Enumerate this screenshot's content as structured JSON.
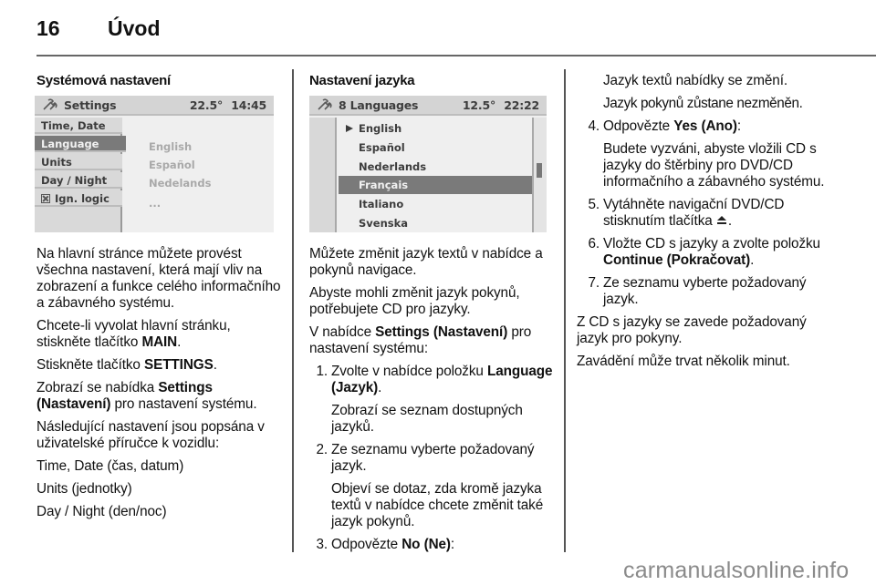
{
  "header": {
    "page_number": "16",
    "chapter_title": "Úvod"
  },
  "left_column": {
    "heading": "Systémová nastavení",
    "screen": {
      "title": "Settings",
      "icon": "wrench-icon",
      "temperature": "22.5°",
      "time": "14:45",
      "menu_items": [
        {
          "label": "Time, Date",
          "selected": false
        },
        {
          "label": "Language",
          "selected": true
        },
        {
          "label": "Units",
          "selected": false
        },
        {
          "label": "Day / Night",
          "selected": false
        },
        {
          "label": "Ign. logic",
          "selected": false,
          "checkbox": "checked-x"
        }
      ],
      "options": [
        "English",
        "Español",
        "Nedelands",
        "..."
      ]
    },
    "paragraphs": {
      "p1": "Na hlavní stránce můžete provést všechna nastavení, která mají vliv na zobrazení a funkce celého informačního a zábavného systému.",
      "p2_a": "Chcete-li vyvolat hlavní stránku, stiskněte tlačítko ",
      "p2_b": "MAIN",
      "p2_c": ".",
      "p3_a": "Stiskněte tlačítko ",
      "p3_b": "SETTINGS",
      "p3_c": ".",
      "p4_a": "Zobrazí se nabídka ",
      "p4_b": "Settings (Nastavení)",
      "p4_c": " pro nastavení systému.",
      "p5": "Následující nastavení jsou popsána v uživatelské příručce k vozidlu:",
      "p6": "Time, Date (čas, datum)",
      "p7": "Units (jednotky)",
      "p8": "Day / Night (den/noc)"
    }
  },
  "middle_column": {
    "heading": "Nastavení jazyka",
    "screen": {
      "title": "8 Languages",
      "icon": "wrench-icon",
      "temperature": "12.5°",
      "time": "22:22",
      "languages": [
        {
          "label": "English",
          "current": true,
          "selected": false
        },
        {
          "label": "Español",
          "current": false,
          "selected": false
        },
        {
          "label": "Nederlands",
          "current": false,
          "selected": false
        },
        {
          "label": "Français",
          "current": false,
          "selected": true
        },
        {
          "label": "Italiano",
          "current": false,
          "selected": false
        },
        {
          "label": "Svenska",
          "current": false,
          "selected": false
        }
      ],
      "scroll_position": 0.45
    },
    "paragraphs": {
      "p1": "Můžete změnit jazyk textů v nabídce a pokynů navigace.",
      "p2": "Abyste mohli změnit jazyk pokynů, potřebujete CD pro jazyky.",
      "p3_a": "V nabídce ",
      "p3_b": "Settings (Nastavení)",
      "p3_c": " pro nastavení systému:",
      "step1_num": "1.",
      "step1_a": "Zvolte v nabídce položku ",
      "step1_b": "Language (Jazyk)",
      "step1_c": ".",
      "step1_note": "Zobrazí se seznam dostupných jazyků.",
      "step2_num": "2.",
      "step2": "Ze seznamu vyberte požadovaný jazyk.",
      "step2_note": "Objeví se dotaz, zda kromě jazyka textů v nabídce chcete změnit také jazyk pokynů.",
      "step3_num": "3.",
      "step3_a": "Odpovězte ",
      "step3_b": "No (Ne)",
      "step3_c": ":"
    }
  },
  "right_column": {
    "paragraphs": {
      "note_a": "Jazyk textů nabídky se změní.",
      "note_b": "Jazyk pokynů zůstane nezměněn.",
      "step4_num": "4.",
      "step4_a": "Odpovězte ",
      "step4_b": "Yes (Ano)",
      "step4_c": ":",
      "step4_note": "Budete vyzváni, abyste vložili CD s jazyky do štěrbiny pro DVD/CD informačního a zábavného systému.",
      "step5_num": "5.",
      "step5_a": "Vytáhněte navigační DVD/CD stisknutím tlačítka ",
      "step5_icon": "eject-icon",
      "step5_c": ".",
      "step6_num": "6.",
      "step6_a": "Vložte CD s jazyky a zvolte položku ",
      "step6_b": "Continue (Pokračovat)",
      "step6_c": ".",
      "step7_num": "7.",
      "step7": "Ze seznamu vyberte požadovaný jazyk.",
      "p_after1": "Z CD s jazyky se zavede požadovaný jazyk pro pokyny.",
      "p_after2": "Zavádění může trvat několik minut."
    }
  },
  "watermark": "carmanualsonline.info"
}
